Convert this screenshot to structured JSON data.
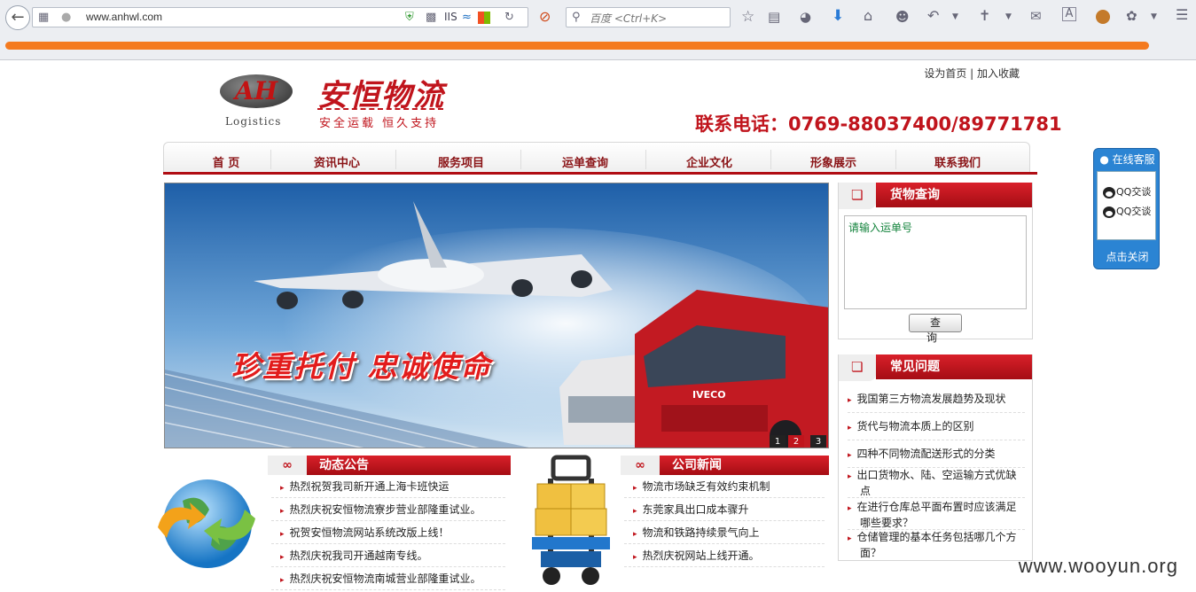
{
  "browser": {
    "url": "www.anhwl.com",
    "iis_label": "IIS",
    "search_placeholder": "百度 <Ctrl+K>"
  },
  "site": {
    "top_links": "设为首页 | 加入收藏",
    "logo_letters": "AH",
    "logo_sub": "Logistics",
    "brand_name": "安恒物流",
    "brand_slogan": "安全运载  恒久支持",
    "hotline": "联系电话：0769-88037400/89771781",
    "nav": [
      "首 页",
      "资讯中心",
      "服务项目",
      "运单查询",
      "企业文化",
      "形象展示",
      "联系我们"
    ],
    "banner_caption": "珍重托付  忠诚使命",
    "banner_truck_brand": "IVECO",
    "banner_pages": [
      "1",
      "2",
      "3"
    ],
    "banner_active_page": 2,
    "cargo_query": {
      "title": "货物查询",
      "placeholder": "请输入运单号",
      "button": "查 询"
    },
    "faq": {
      "title": "常见问题",
      "items": [
        "我国第三方物流发展趋势及现状",
        "货代与物流本质上的区别",
        "四种不同物流配送形式的分类",
        "出口货物水、陆、空运输方式优缺点",
        "在进行仓库总平面布置时应该满足哪些要求？",
        "仓储管理的基本任务包括哪几个方面？"
      ]
    },
    "announcements": {
      "title": "动态公告",
      "items": [
        "热烈祝贺我司新开通上海卡班快运",
        "热烈庆祝安恒物流寮步营业部隆重试业。",
        "祝贺安恒物流网站系统改版上线！",
        "热烈庆祝我司开通越南专线。",
        "热烈庆祝安恒物流南城营业部隆重试业。"
      ]
    },
    "company_news": {
      "title": "公司新闻",
      "items": [
        "物流市场缺乏有效约束机制",
        "东莞家具出口成本骤升",
        "物流和铁路持续景气向上",
        "热烈庆祝网站上线开通。"
      ]
    },
    "section_icon": "∞",
    "qq_widget": {
      "title": "在线客服",
      "links": [
        "QQ交谈",
        "QQ交谈"
      ],
      "close": "点击关闭"
    }
  },
  "watermark": "www.wooyun.org",
  "colors": {
    "brand_red": "#c0141c",
    "qq_blue": "#2b84d3",
    "highlight_orange": "#f47a1f"
  }
}
